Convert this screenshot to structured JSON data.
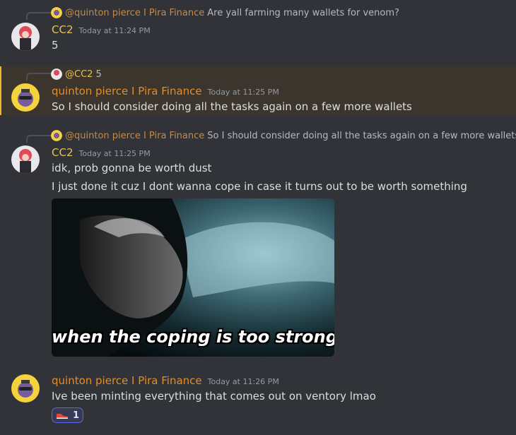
{
  "messages": [
    {
      "reply_name": "@quinton pierce I Pira Finance",
      "reply_text": "Are yall farming many wallets for venom?",
      "author": "CC2",
      "timestamp": "Today at 11:24 PM",
      "lines": [
        "5"
      ]
    },
    {
      "reply_name": "@CC2",
      "reply_text": "5",
      "author": "quinton pierce I Pira Finance",
      "timestamp": "Today at 11:25 PM",
      "lines": [
        "So I should consider doing all the tasks again on a few more wallets"
      ],
      "highlighted": true
    },
    {
      "reply_name": "@quinton pierce I Pira Finance",
      "reply_text": "So I should consider doing all the tasks again on a few more wallets",
      "author": "CC2",
      "timestamp": "Today at 11:25 PM",
      "lines": [
        "idk, prob gonna be worth dust",
        "I just done it cuz I dont wanna cope in case it turns out to be worth something"
      ],
      "gif_caption": "when the coping is too strong"
    },
    {
      "author": "quinton pierce I Pira Finance",
      "timestamp": "Today at 11:26 PM",
      "lines": [
        "Ive been minting everything that comes out on ventory lmao"
      ],
      "reaction": {
        "emoji_icon": "shoe-icon",
        "count": "1"
      }
    }
  ],
  "colors": {
    "background": "#313338",
    "mention_highlight": "#3b352e",
    "mention_bar": "#f0b232",
    "cc2_name": "#e8c350",
    "quinton_name": "#e08d2d",
    "reaction_border": "#5865f2"
  }
}
